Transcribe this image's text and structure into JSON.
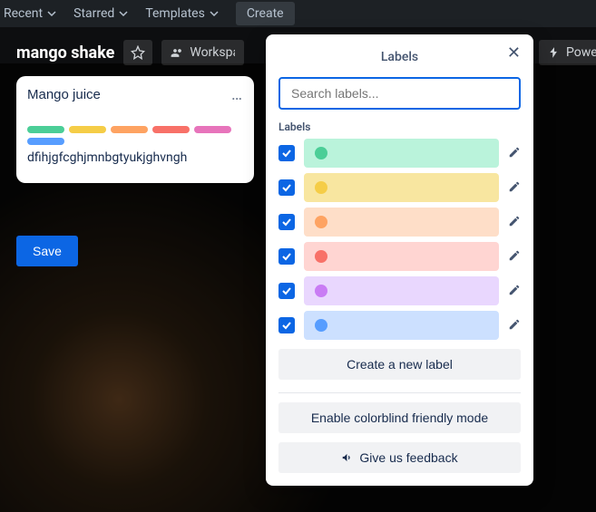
{
  "nav": {
    "recent": "Recent",
    "starred": "Starred",
    "templates": "Templates",
    "create": "Create"
  },
  "board": {
    "title": "mango shake",
    "workspace_btn": "Workspace visible",
    "powerups_btn": "Power-Ups"
  },
  "card": {
    "title": "Mango juice",
    "desc": "dfihjgfcghjmnbgtyukjghvngh",
    "pill_colors": [
      "#4bce97",
      "#f5cd47",
      "#fea362",
      "#f87168",
      "#e774bb",
      "#579dff"
    ],
    "save": "Save"
  },
  "popover": {
    "title": "Labels",
    "search_placeholder": "Search labels...",
    "section": "Labels",
    "labels": [
      {
        "bar": "#baf3db",
        "dot": "#4bce97"
      },
      {
        "bar": "#f8e6a0",
        "dot": "#f5cd47"
      },
      {
        "bar": "#fedec8",
        "dot": "#fea362"
      },
      {
        "bar": "#ffd5d2",
        "dot": "#f87168"
      },
      {
        "bar": "#e9d7fe",
        "dot": "#c97cf4"
      },
      {
        "bar": "#cce0ff",
        "dot": "#579dff"
      }
    ],
    "create_label": "Create a new label",
    "colorblind": "Enable colorblind friendly mode",
    "feedback": "Give us feedback"
  }
}
